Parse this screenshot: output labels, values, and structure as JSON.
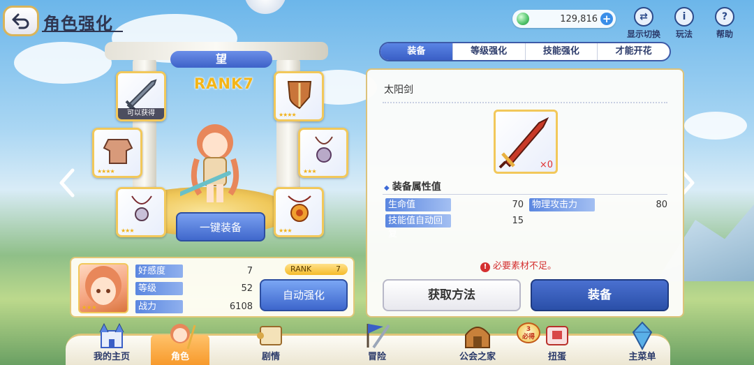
{
  "header": {
    "title": "角色强化",
    "gems": "129,816",
    "tools": [
      {
        "label": "显示切换",
        "icon": "swap-icon"
      },
      {
        "label": "玩法",
        "icon": "info-icon"
      },
      {
        "label": "帮助",
        "icon": "help-icon"
      }
    ]
  },
  "character": {
    "name": "望",
    "rank": "RANK7",
    "obtainable": "可以获得",
    "equip_all": "一键装备"
  },
  "stats": {
    "affection": {
      "label": "好感度",
      "value": "7"
    },
    "level": {
      "label": "等级",
      "value": "52"
    },
    "power": {
      "label": "战力",
      "value": "6108"
    },
    "rank_label": "RANK",
    "rank_value": "7",
    "auto_enhance": "自动强化"
  },
  "tabs": [
    {
      "label": "装备",
      "active": true
    },
    {
      "label": "等级强化",
      "active": false
    },
    {
      "label": "技能强化",
      "active": false
    },
    {
      "label": "才能开花",
      "active": false
    }
  ],
  "item": {
    "name": "太阳剑",
    "quantity": "×0",
    "section_title": "装备属性值",
    "attributes": [
      {
        "label": "生命值",
        "value": "70"
      },
      {
        "label": "物理攻击力",
        "value": "80"
      },
      {
        "label": "技能值自动回复",
        "value": "15"
      }
    ],
    "warning": "必要素材不足。",
    "obtain_label": "获取方法",
    "equip_label": "装备"
  },
  "nav": [
    {
      "label": "我的主页",
      "icon": "castle-icon"
    },
    {
      "label": "角色",
      "icon": "character-icon",
      "active": true
    },
    {
      "label": "剧情",
      "icon": "scroll-icon"
    },
    {
      "label": "冒险",
      "icon": "sword-flag-icon"
    },
    {
      "label": "公会之家",
      "icon": "guild-house-icon"
    },
    {
      "label": "扭蛋",
      "icon": "gacha-icon"
    },
    {
      "label": "主菜单",
      "icon": "crystal-icon"
    }
  ],
  "gacha_badge": {
    "count": "3",
    "text": "必得"
  },
  "colors": {
    "accent_blue": "#3a5fc6",
    "gold_border": "#f2c85a",
    "warning_red": "#d43030",
    "active_nav": "#f79a2c"
  }
}
